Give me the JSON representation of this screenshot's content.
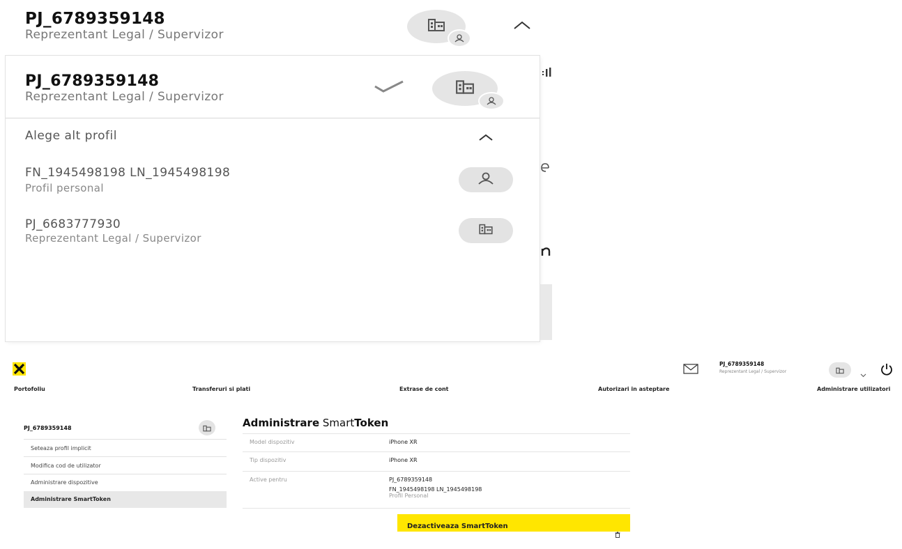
{
  "zoom": {
    "header": {
      "profile_id": "PJ_6789359148",
      "role": "Reprezentant Legal / Supervizor"
    },
    "dropdown": {
      "current": {
        "profile_id": "PJ_6789359148",
        "role": "Reprezentant Legal / Supervizor"
      },
      "choose_label": "Alege alt profil",
      "profiles": [
        {
          "title": "FN_1945498198 LN_1945498198",
          "subtitle": "Profil personal",
          "icon": "person-icon"
        },
        {
          "title": "PJ_6683777930",
          "subtitle": "Reprezentant Legal / Supervizor",
          "icon": "building-icon"
        }
      ]
    }
  },
  "app": {
    "brand_color": "#ffe600",
    "header": {
      "profile_id": "PJ_6789359148",
      "role": "Reprezentant Legal / Supervizor"
    },
    "nav": [
      "Portofoliu",
      "Transferuri si plati",
      "Extrase de cont",
      "Autorizari in asteptare",
      "Administrare utilizatori"
    ],
    "sidebar": {
      "profile_id": "PJ_6789359148",
      "items": [
        {
          "label": "Seteaza profil implicit",
          "active": false
        },
        {
          "label": "Modifica cod de utilizator",
          "active": false
        },
        {
          "label": "Administrare dispozitive",
          "active": false
        },
        {
          "label": "Administrare SmartToken",
          "active": true
        }
      ]
    },
    "main": {
      "title_bold_1": "Administrare",
      "title_regular": " Smart",
      "title_bold_2": "Token",
      "rows": [
        {
          "label": "Model dispozitiv",
          "value": "iPhone XR"
        },
        {
          "label": "Tip dispozitiv",
          "value": "iPhone XR"
        },
        {
          "label": "Active pentru",
          "value": "PJ_6789359148",
          "value2": "FN_1945498198 LN_1945498198",
          "value3": "Profil Personal"
        }
      ],
      "deactivate_label": "Dezactiveaza SmartToken"
    }
  }
}
